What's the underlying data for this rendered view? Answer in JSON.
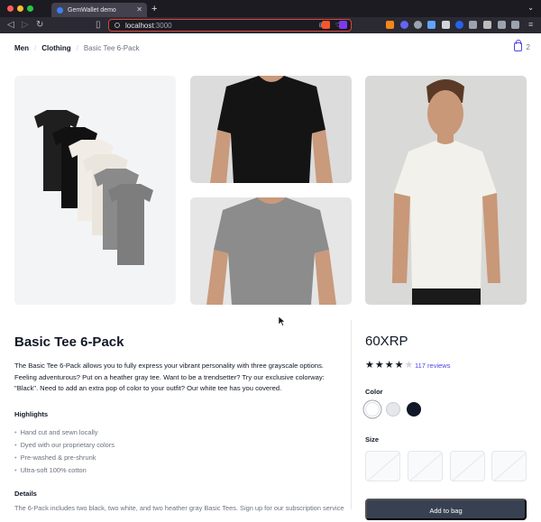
{
  "browser": {
    "tab_title": "GemWallet demo",
    "url_host": "localhost",
    "url_port": ":3000"
  },
  "breadcrumb": [
    "Men",
    "Clothing",
    "Basic Tee 6-Pack"
  ],
  "cart": {
    "count": "2"
  },
  "product": {
    "title": "Basic Tee 6-Pack",
    "description": "The Basic Tee 6-Pack allows you to fully express your vibrant personality with three grayscale options. Feeling adventurous? Put on a heather gray tee. Want to be a trendsetter? Try our exclusive colorway: \"Black\". Need to add an extra pop of color to your outfit? Our white tee has you covered.",
    "price": "60XRP",
    "rating": 4,
    "rating_max": 5,
    "reviews_label": "117 reviews",
    "highlights_label": "Highlights",
    "highlights": [
      "Hand cut and sewn locally",
      "Dyed with our proprietary colors",
      "Pre-washed & pre-shrunk",
      "Ultra-soft 100% cotton"
    ],
    "details_label": "Details",
    "details_text": "The 6-Pack includes two black, two white, and two heather gray Basic Tees. Sign up for our subscription service",
    "color_label": "Color",
    "colors": [
      {
        "name": "White",
        "hex": "#ffffff",
        "selected": true
      },
      {
        "name": "Gray",
        "hex": "#e5e7eb",
        "selected": false
      },
      {
        "name": "Black",
        "hex": "#111827",
        "selected": false
      }
    ],
    "size_label": "Size",
    "sizes_available": [
      false,
      false,
      false,
      false
    ],
    "add_to_bag_label": "Add to bag"
  },
  "colors": {
    "accent": "#4f46e5",
    "text": "#111827",
    "muted": "#6b7280"
  }
}
